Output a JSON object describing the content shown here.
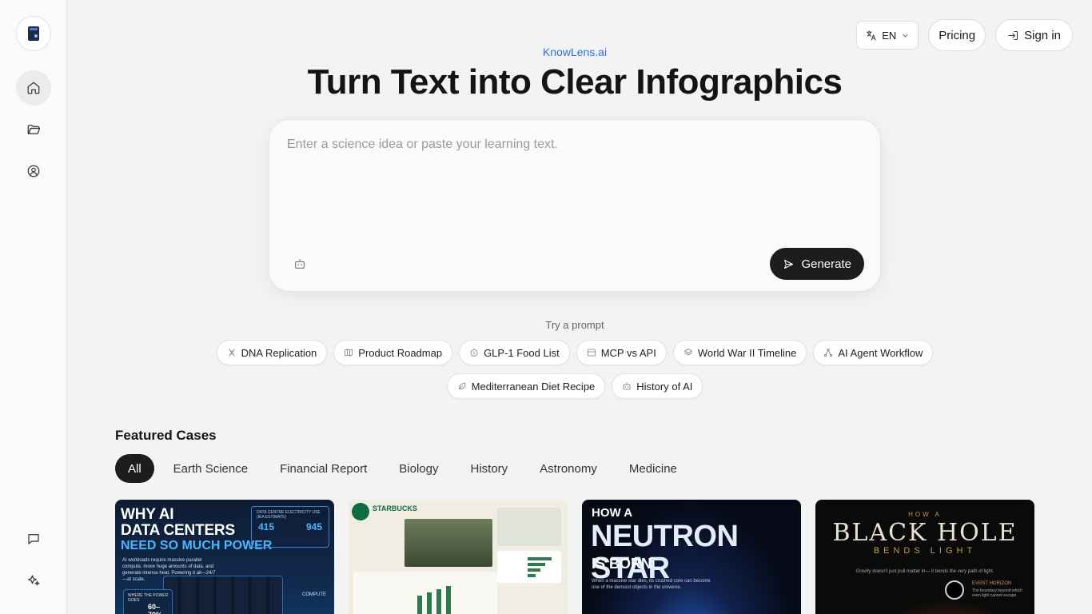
{
  "brand": {
    "tagline": "KnowLens.ai"
  },
  "hero": {
    "headline": "Turn Text into Clear Infographics",
    "placeholder": "Enter a science idea or paste your learning text.",
    "generate_label": "Generate"
  },
  "topbar": {
    "language": "EN",
    "pricing": "Pricing",
    "signin": "Sign in"
  },
  "prompts": {
    "label": "Try a prompt",
    "row1": [
      {
        "label": "DNA Replication",
        "icon": "dna-icon"
      },
      {
        "label": "Product Roadmap",
        "icon": "map-icon"
      },
      {
        "label": "GLP-1 Food List",
        "icon": "apple-icon"
      },
      {
        "label": "MCP vs API",
        "icon": "table-icon"
      },
      {
        "label": "World War II Timeline",
        "icon": "layers-icon"
      },
      {
        "label": "AI Agent Workflow",
        "icon": "workflow-icon"
      }
    ],
    "row2": [
      {
        "label": "Mediterranean Diet Recipe",
        "icon": "leaf-icon"
      },
      {
        "label": "History of AI",
        "icon": "bot-icon"
      }
    ]
  },
  "featured": {
    "title": "Featured Cases",
    "tabs": [
      "All",
      "Earth Science",
      "Financial Report",
      "Biology",
      "History",
      "Astronomy",
      "Medicine"
    ],
    "cards": [
      {
        "line1": "WHY AI",
        "line2": "DATA CENTERS",
        "line3": "NEED SO MUCH POWER",
        "desc": "AI workloads require massive parallel compute, move huge amounts of data, and generate intense heat. Powering it all—24/7—at scale.",
        "box_label": "DATA CENTRE ELECTRICITY USE (IEA ESTIMATE)",
        "value_from": "415",
        "value_to": "945",
        "badge_label": "WHERE THE POWER GOES",
        "badge_value": "60–70%",
        "side_label": "COMPUTE"
      },
      {
        "brand": "STARBUCKS"
      },
      {
        "line1": "HOW A",
        "line2": "NEUTRON STAR",
        "line3": "IS BORN",
        "desc": "When a massive star dies, its crushed core can become one of the densest objects in the universe."
      },
      {
        "line1": "HOW A",
        "line2": "BLACK HOLE",
        "line3": "BENDS LIGHT",
        "desc": "Gravity doesn't just pull matter in— it bends the very path of light.",
        "event_label": "EVENT HORIZON",
        "event_desc": "The boundary beyond which even light cannot escape."
      }
    ]
  }
}
